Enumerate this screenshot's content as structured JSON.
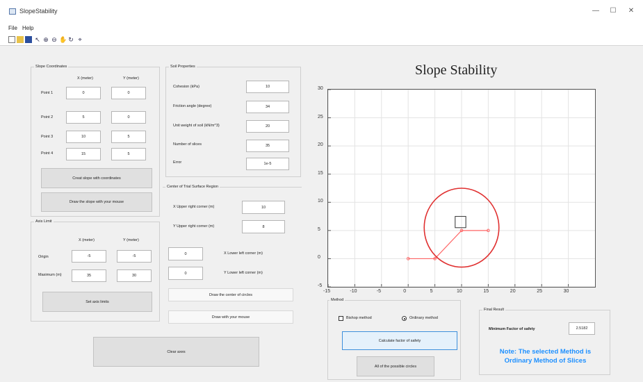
{
  "window": {
    "title": "SlopeStability",
    "min": "—",
    "max": "☐",
    "close": "✕"
  },
  "menu": [
    "File",
    "Help"
  ],
  "toolbar": [
    "new",
    "open",
    "save",
    "zoom-in",
    "zoom-out",
    "pan",
    "rotate",
    "print"
  ],
  "slope": {
    "title": "Slope Coordinates",
    "x_header": "X (meter)",
    "y_header": "Y (meter)",
    "points": [
      {
        "label": "Point 1",
        "x": "0",
        "y": "0"
      },
      {
        "label": "Point 2",
        "x": "5",
        "y": "0"
      },
      {
        "label": "Point 3",
        "x": "10",
        "y": "5"
      },
      {
        "label": "Point 4",
        "x": "15",
        "y": "5"
      }
    ],
    "create_btn": "Creat slope with coordinates",
    "draw_btn": "Draw the slope with your mouse"
  },
  "axes_limit": {
    "title": "Axis Limit",
    "x_header": "X (meter)",
    "y_header": "Y (meter)",
    "origin_label": "Origin",
    "origin_x": "-5",
    "origin_y": "-5",
    "max_label": "Maximum (m)",
    "max_x": "35",
    "max_y": "30",
    "set_btn": "Set axis limits"
  },
  "soil": {
    "title": "Soil Properties",
    "rows": [
      {
        "label": "Cohesion (kPa)",
        "value": "10"
      },
      {
        "label": "Friction angle (degree)",
        "value": "34"
      },
      {
        "label": "Unit weight of soil (kN/m^3)",
        "value": "20"
      },
      {
        "label": "Number of slices",
        "value": "35"
      },
      {
        "label": "Error",
        "value": "1e-5"
      }
    ]
  },
  "center": {
    "title": "Center of Trial Surface Region",
    "xu_label": "X Upper right corner (m)",
    "xu": "10",
    "yu_label": "Y Upper right corner (m)",
    "yu": "8",
    "xl_label": "X Lower left corner (m)",
    "xl": "0",
    "yl_label": "Y Lower left corner (m)",
    "yl": "0",
    "draw_center_btn": "Draw the center of circles",
    "draw_mouse_btn": "Draw with your mouse"
  },
  "clear_btn": "Clear axes",
  "plot": {
    "title": "Slope Stability"
  },
  "method": {
    "title": "Method",
    "bishop": "Bishop method",
    "ordinary": "Ordinary method",
    "selected": "ordinary",
    "calc_btn": "Calculate factor of safety",
    "all_btn": "All of the possible circles"
  },
  "result": {
    "title": "Final Result",
    "min_fs_label": "Minimum Factor of safety",
    "min_fs": "2.5182",
    "note_line1": "Note: The selected Method is",
    "note_line2": "Ordinary Method of Slices"
  },
  "chart_data": {
    "type": "scatter",
    "title": "Slope Stability",
    "xlim": [
      -15,
      35
    ],
    "ylim": [
      -5,
      30
    ],
    "xticks": [
      "-15",
      "-10",
      "-5",
      "0",
      "5",
      "10",
      "15",
      "20",
      "25",
      "30"
    ],
    "yticks": [
      "-5",
      "0",
      "5",
      "10",
      "15",
      "20",
      "25",
      "30"
    ],
    "grid": true,
    "slope_line": {
      "x": [
        0,
        5,
        10,
        15
      ],
      "y": [
        0,
        0,
        5,
        5
      ],
      "color": "#ff6666"
    },
    "circle": {
      "cx": 10,
      "cy": 5.5,
      "r": 7,
      "color": "#e03030"
    },
    "center_square": {
      "x": [
        8.8,
        10.8
      ],
      "y": [
        5.5,
        7.5
      ],
      "color": "#333333"
    }
  }
}
